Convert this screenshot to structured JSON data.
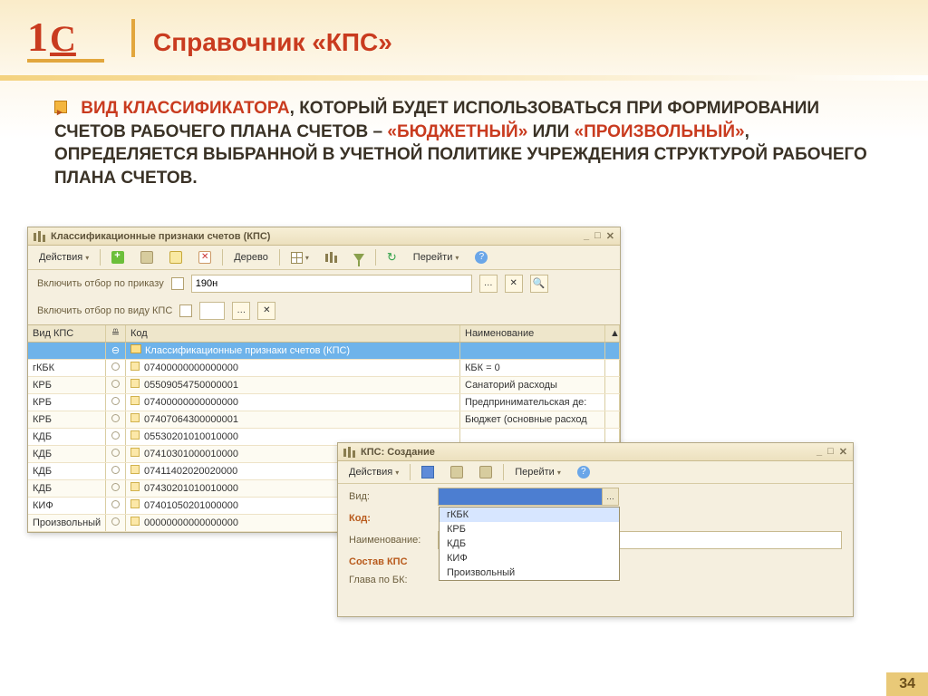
{
  "slide": {
    "title": "Справочник «КПС»",
    "page_num": "34",
    "body_pre": "Вид классификатора",
    "body_mid1": ", который будет использоваться при формировании счетов рабочего плана счетов – ",
    "body_hl2": "«Бюджетный»",
    "body_mid2": " или ",
    "body_hl3": "«Произвольный»",
    "body_post": ", определяется выбранной в Учетной политике учреждения структурой рабочего плана счетов."
  },
  "win1": {
    "title": "Классификационные признаки счетов (КПС)",
    "actions": "Действия",
    "tree": "Дерево",
    "goto": "Перейти",
    "filter_order_label": "Включить отбор по приказу",
    "filter_order_value": "190н",
    "filter_kind_label": "Включить отбор по виду КПС",
    "hdr_vid": "Вид КПС",
    "hdr_kod": "Код",
    "hdr_nm": "Наименование",
    "folder": "Классификационные признаки счетов (КПС)",
    "rows": [
      {
        "vid": "гКБК",
        "kod": "07400000000000000",
        "nm": "КБК = 0"
      },
      {
        "vid": "КРБ",
        "kod": "05509054750000001",
        "nm": "Санаторий расходы"
      },
      {
        "vid": "КРБ",
        "kod": "07400000000000000",
        "nm": "Предпринимательская де:"
      },
      {
        "vid": "КРБ",
        "kod": "07407064300000001",
        "nm": "Бюджет (основные расход"
      },
      {
        "vid": "КДБ",
        "kod": "05530201010010000",
        "nm": ""
      },
      {
        "vid": "КДБ",
        "kod": "07410301000010000",
        "nm": ""
      },
      {
        "vid": "КДБ",
        "kod": "07411402020020000",
        "nm": ""
      },
      {
        "vid": "КДБ",
        "kod": "07430201010010000",
        "nm": ""
      },
      {
        "vid": "КИФ",
        "kod": "07401050201000000",
        "nm": ""
      },
      {
        "vid": "Произвольный",
        "kod": "00000000000000000",
        "nm": ""
      }
    ]
  },
  "win2": {
    "title": "КПС: Создание",
    "actions": "Действия",
    "goto": "Перейти",
    "lbl_vid": "Вид:",
    "lbl_kod": "Код:",
    "lbl_nm": "Наименование:",
    "lbl_sostav": "Состав КПС",
    "lbl_glava": "Глава по БК:",
    "options": [
      "гКБК",
      "КРБ",
      "КДБ",
      "КИФ",
      "Произвольный"
    ]
  }
}
